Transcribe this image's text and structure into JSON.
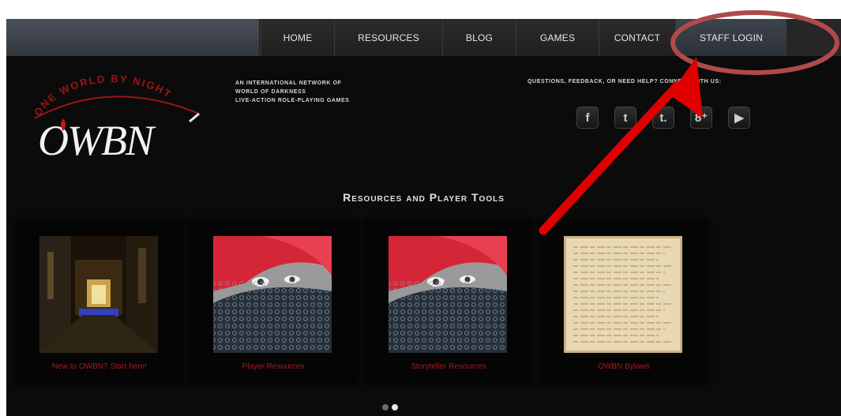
{
  "nav": {
    "items": [
      {
        "label": "Home",
        "width": 92
      },
      {
        "label": "Resources",
        "width": 136
      },
      {
        "label": "Blog",
        "width": 92
      },
      {
        "label": "Games",
        "width": 104
      },
      {
        "label": "Contact",
        "width": 96
      },
      {
        "label": "Staff Login",
        "width": 140
      }
    ]
  },
  "header": {
    "logo_arc_text": "ONE WORLD BY NIGHT",
    "logo_text": "OWBN",
    "tagline": [
      "An international network of",
      "World of Darkness",
      "live-action role-playing games"
    ],
    "connect": "Questions, feedback, or need help? Connect with us:"
  },
  "social": [
    {
      "name": "facebook",
      "glyph": "f"
    },
    {
      "name": "twitter",
      "glyph": "t"
    },
    {
      "name": "tumblr",
      "glyph": "t."
    },
    {
      "name": "google-plus",
      "glyph": "8⁺"
    },
    {
      "name": "youtube",
      "glyph": "▶"
    }
  ],
  "section_title": "Resources and Player Tools",
  "cards": [
    {
      "caption": "New to OWBN? Start here!",
      "image": "alley-night"
    },
    {
      "caption": "Player Resources",
      "image": "red-hair-fan"
    },
    {
      "caption": "Storyteller Resources",
      "image": "red-hair-fan"
    },
    {
      "caption": "OWBN Bylaws",
      "image": "parchment"
    }
  ],
  "carousel": {
    "pages": 2,
    "current": 2
  },
  "colors": {
    "accent_red": "#a81b1b",
    "annotation_red": "#e00000",
    "annotation_circle": "#b04a4a"
  }
}
